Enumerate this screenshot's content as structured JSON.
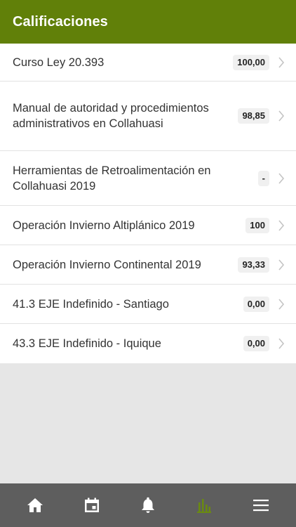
{
  "header": {
    "title": "Calificaciones"
  },
  "courses": [
    {
      "name": "Curso Ley 20.393",
      "grade": "100,00"
    },
    {
      "name": "Manual de autoridad y procedimientos administrativos en Collahuasi",
      "grade": "98,85"
    },
    {
      "name": "Herramientas de Retroalimentación en Collahuasi 2019",
      "grade": "-"
    },
    {
      "name": "Operación Invierno Altiplánico 2019",
      "grade": "100"
    },
    {
      "name": "Operación Invierno Continental 2019",
      "grade": "93,33"
    },
    {
      "name": "41.3 EJE Indefinido - Santiago",
      "grade": "0,00"
    },
    {
      "name": "43.3 EJE Indefinido - Iquique",
      "grade": "0,00"
    }
  ],
  "tabbar": {
    "items": [
      {
        "icon": "home-icon"
      },
      {
        "icon": "calendar-icon"
      },
      {
        "icon": "bell-icon"
      },
      {
        "icon": "bar-chart-icon",
        "active": true
      },
      {
        "icon": "menu-icon"
      }
    ]
  },
  "colors": {
    "header": "#618009",
    "tabbar": "#5e5e5e",
    "active_tab": "#6a8a10",
    "inactive_tab": "#ffffff"
  }
}
